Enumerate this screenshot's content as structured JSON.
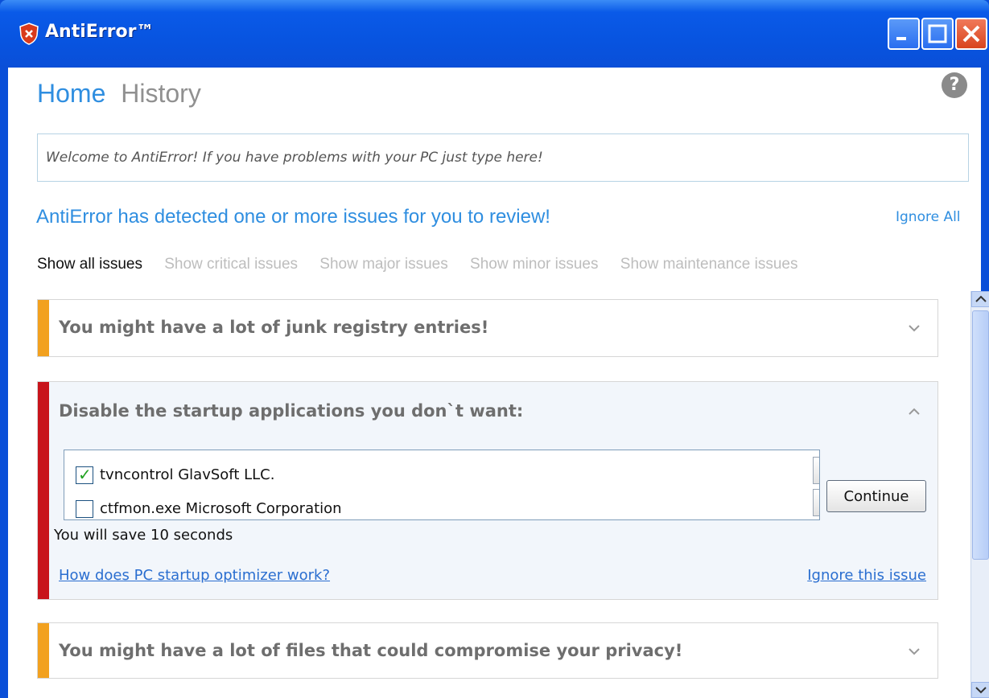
{
  "window": {
    "title": "AntiError™"
  },
  "nav": {
    "home": "Home",
    "history": "History",
    "help": "?"
  },
  "search": {
    "placeholder": "Welcome to AntiError! If you have problems with your PC just type here!"
  },
  "notice": {
    "text": "AntiError has detected one or more issues for you to review!",
    "ignore_all": "Ignore All"
  },
  "filters": [
    {
      "label": "Show all issues",
      "active": true
    },
    {
      "label": "Show critical issues",
      "active": false
    },
    {
      "label": "Show major issues",
      "active": false
    },
    {
      "label": "Show minor issues",
      "active": false
    },
    {
      "label": "Show maintenance issues",
      "active": false
    }
  ],
  "issues": [
    {
      "title": "You might have a lot of junk registry entries!",
      "severity_color": "#f2a11f"
    },
    {
      "title": "Disable the startup applications you don`t want:",
      "severity_color": "#c8141b",
      "apps": [
        {
          "label": "tvncontrol GlavSoft LLC.",
          "checked": true
        },
        {
          "label": "ctfmon.exe Microsoft Corporation",
          "checked": false
        }
      ],
      "continue": "Continue",
      "save_text": "You will save 10 seconds",
      "how_link": "How does PC startup optimizer work?",
      "ignore_link": "Ignore this issue"
    },
    {
      "title": "You might have a lot of files that could compromise your privacy!",
      "severity_color": "#f2a11f"
    }
  ],
  "icons": {
    "chevron_down": "chevron-down-icon",
    "chevron_up": "chevron-up-icon",
    "scroll_up": "▲",
    "scroll_down": "▼"
  }
}
